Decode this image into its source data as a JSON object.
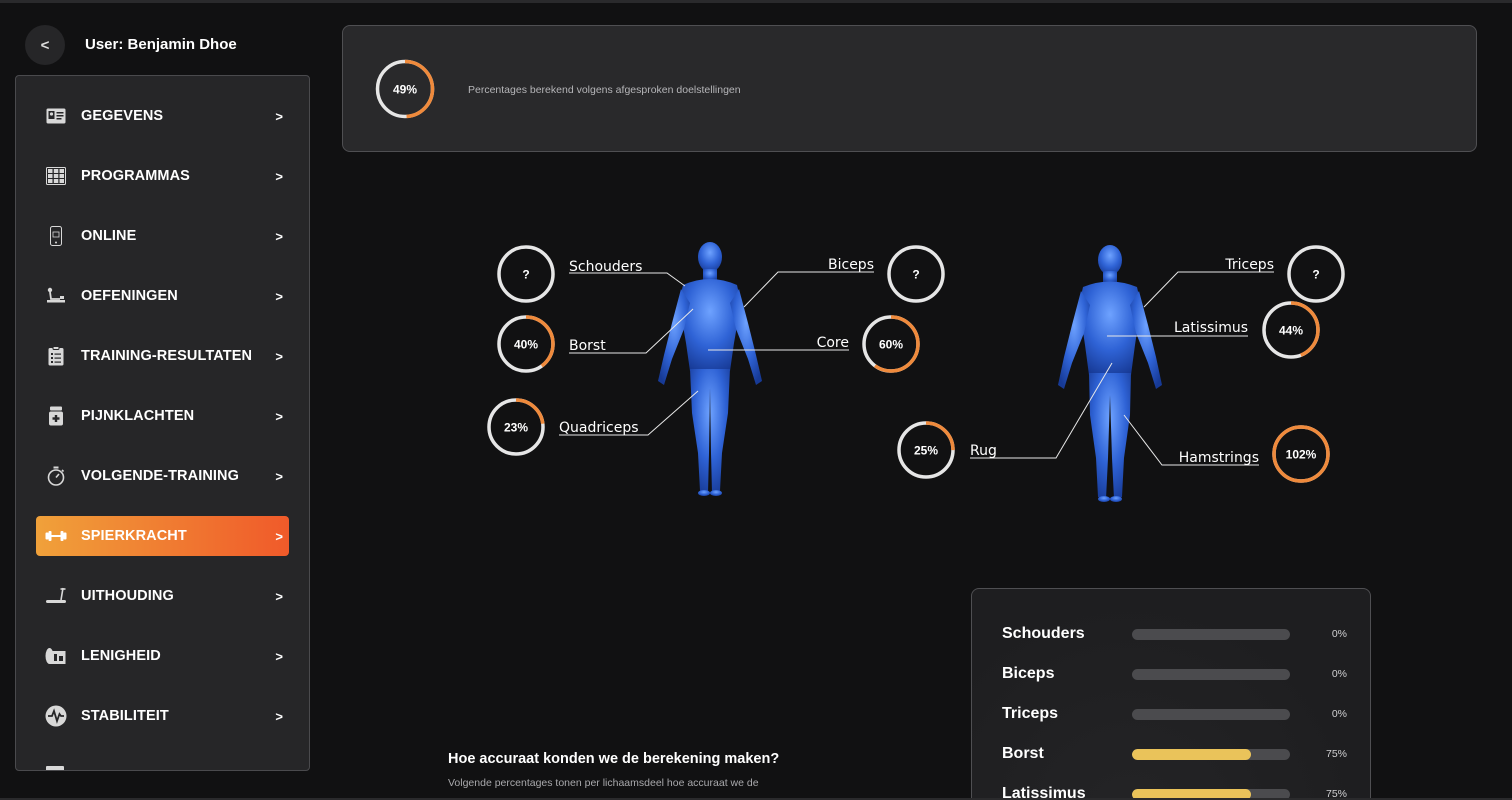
{
  "header": {
    "back_label": "<",
    "user_label": "User: Benjamin Dhoe"
  },
  "sidebar": {
    "items": [
      {
        "label": "GEGEVENS",
        "icon": "id-card-icon",
        "arrow": ">"
      },
      {
        "label": "PROGRAMMAS",
        "icon": "calendar-grid-icon",
        "arrow": ">"
      },
      {
        "label": "ONLINE",
        "icon": "smartphone-icon",
        "arrow": ">"
      },
      {
        "label": "OEFENINGEN",
        "icon": "exercise-machine-icon",
        "arrow": ">"
      },
      {
        "label": "TRAINING-RESULTATEN",
        "icon": "clipboard-icon",
        "arrow": ">"
      },
      {
        "label": "PIJNKLACHTEN",
        "icon": "medicine-jar-icon",
        "arrow": ">"
      },
      {
        "label": "VOLGENDE-TRAINING",
        "icon": "stopwatch-icon",
        "arrow": ">"
      },
      {
        "label": "SPIERKRACHT",
        "icon": "dumbbell-icon",
        "arrow": ">",
        "active": true
      },
      {
        "label": "UITHOUDING",
        "icon": "treadmill-icon",
        "arrow": ">"
      },
      {
        "label": "LENIGHEID",
        "icon": "yoga-mat-icon",
        "arrow": ">"
      },
      {
        "label": "STABILITEIT",
        "icon": "heartbeat-icon",
        "arrow": ">"
      }
    ]
  },
  "summary": {
    "total_pct": "49%",
    "total_value": 0.49,
    "note": "Percentages berekend volgens afgesproken doelstellingen"
  },
  "front_muscles": [
    {
      "label": "Schouders",
      "value_text": "?",
      "value": 0
    },
    {
      "label": "Borst",
      "value_text": "40%",
      "value": 0.4
    },
    {
      "label": "Quadriceps",
      "value_text": "23%",
      "value": 0.23
    },
    {
      "label": "Biceps",
      "value_text": "?",
      "value": 0
    },
    {
      "label": "Core",
      "value_text": "60%",
      "value": 0.6
    }
  ],
  "back_muscles": [
    {
      "label": "Triceps",
      "value_text": "?",
      "value": 0
    },
    {
      "label": "Latissimus",
      "value_text": "44%",
      "value": 0.44
    },
    {
      "label": "Rug",
      "value_text": "25%",
      "value": 0.25
    },
    {
      "label": "Hamstrings",
      "value_text": "102%",
      "value": 1.02
    }
  ],
  "accuracy": {
    "title": "Hoe accuraat konden we de berekening maken?",
    "description": "Volgende percentages tonen per lichaamsdeel hoe accuraat we de berekening van het model hebben kunnen maken. Hoe meer",
    "rows": [
      {
        "name": "Schouders",
        "pct": "0%",
        "value": 0
      },
      {
        "name": "Biceps",
        "pct": "0%",
        "value": 0
      },
      {
        "name": "Triceps",
        "pct": "0%",
        "value": 0
      },
      {
        "name": "Borst",
        "pct": "75%",
        "value": 0.75
      },
      {
        "name": "Latissimus",
        "pct": "75%",
        "value": 0.75
      }
    ]
  },
  "colors": {
    "accent_orange": "#ef8a3c",
    "ring_track": "#e6e6e6",
    "bar_fill": "#eac35a",
    "body_blue": "#3a6fe0"
  }
}
